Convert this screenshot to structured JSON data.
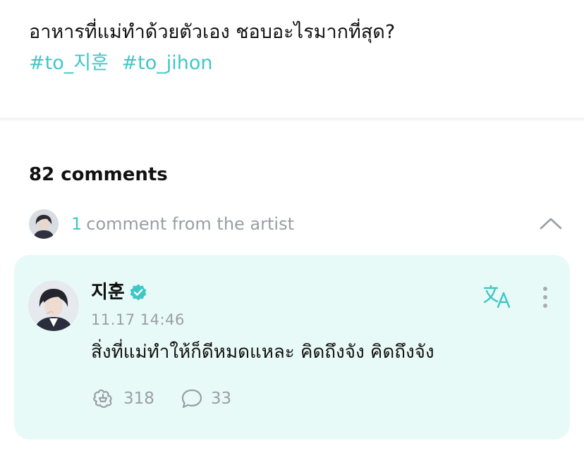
{
  "post": {
    "text": "อาหารที่แม่ทำด้วยตัวเอง ชอบอะไรมากที่สุด?",
    "hashtags": [
      "#to_지훈",
      "#to_jihon"
    ]
  },
  "comments": {
    "count_label": "82 comments",
    "artist_summary": {
      "count": "1",
      "label": "comment from the artist",
      "collapse_icon": "chevron-up-icon"
    }
  },
  "artist_comment": {
    "author": "지훈",
    "verified_icon": "verified-badge-icon",
    "timestamp": "11.17 14:46",
    "text": "สิ่งที่แม่ทำให้ก็ดีหมดแหละ คิดถึงจัง คิดถึงจัง",
    "likes": "318",
    "replies": "33",
    "translate_icon": "translate-icon",
    "more_icon": "more-vertical-icon"
  },
  "colors": {
    "accent": "#3fc7c6",
    "card_background": "#e8faf7",
    "muted_text": "#9a9ea3"
  }
}
